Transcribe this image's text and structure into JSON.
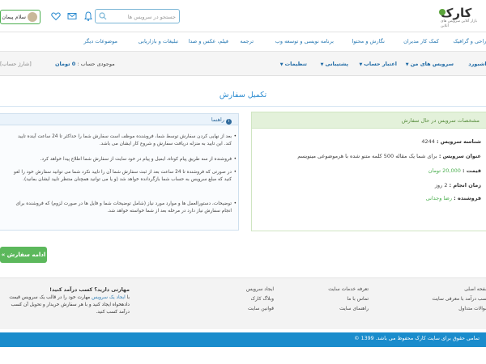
{
  "header": {
    "logo_text": "کارک",
    "logo_sub": "بازار آنلاین سرویس های آنلاین",
    "search_placeholder": "جستجو در سرویس ها",
    "user_name": "سلام پیمان"
  },
  "categories": [
    "طراحی و گرافیک",
    "کمک کار مدیران",
    "نگارش و محتوا",
    "برنامه نویسی و توسعه وب",
    "ترجمه",
    "فیلم، عکس و صدا",
    "تبلیغات و بازاریابی",
    "موضوعات دیگر"
  ],
  "dashboard": {
    "items": [
      "داشبورد",
      "سرویس های من",
      "اعتبار حساب",
      "پشتیبانی",
      "تنظیمات"
    ],
    "balance_label": "موجودی حساب :",
    "balance_value": "0 تومان",
    "charge_link": "[شارژ حساب]"
  },
  "page_title": "تکمیل سفارش",
  "order": {
    "header": "مشخصات سرویس در حال سفارش",
    "rows": [
      {
        "label": "شناسه سرویس :",
        "value": "4244",
        "green": false
      },
      {
        "label": "عنوان سرویس :",
        "value": "برای شما یک مقاله 500 کلمه متنو شده با هرموضوعی مینویسم",
        "green": false
      },
      {
        "label": "قیمت :",
        "value": "20,000 تومان",
        "green": true
      },
      {
        "label": "زمان انجام :",
        "value": "2 روز",
        "green": false
      },
      {
        "label": "فروشنده :",
        "value": "رضا وجدانی",
        "green": true
      }
    ]
  },
  "guide": {
    "header": "راهنما",
    "items": [
      "بعد از نهایی کردن سفارش توسط شما، فروشنده موظف است سفارش شما را حداکثر تا 24 ساعت آینده تایید کند. این تایید به منزله دریافت سفارش و شروع کار ایشان می باشد.",
      "فروشنده از سه طریق پیام کوتاه، ایمیل و پیام در خود سایت از سفارش شما اطلاع پیدا خواهد کرد.",
      "در صورتی که فروشنده تا 24 ساعت بعد از ثبت سفارش شما آن را تایید نکرد شما می توانید سفارش خود را لغو کنید که مبلغ سرویس به حساب شما بازگردانده خواهد شد (و یا می توانید همچنان منتظر تایید ایشان بمانید).",
      "توضیحات، دستورالعمل ها و موارد مورد نیاز (شامل توضیحات شما و فایل ها در صورت لزوم) که فروشنده برای انجام سفارش نیاز دارد در مرحله بعد از شما خواسته خواهد شد."
    ]
  },
  "continue_button": "ادامه سفارش »",
  "footer": {
    "col1": [
      "صفحه اصلی",
      "کسب درآمد با معرفی سایت",
      "سوالات متداول"
    ],
    "col2": [
      "تعرفه خدمات سایت",
      "تماس با ما",
      "راهنمای سایت"
    ],
    "col3": [
      "ایجاد سرویس",
      "وبلاگ کارک",
      "قوانین سایت"
    ],
    "promo_title": "مهارتی دارید؟ کسب درآمد کنید!",
    "promo_text_1": "با",
    "promo_link": "ایجاد یک سرویس",
    "promo_text_2": "مهارت خود را در قالب یک سرویس قیمت دادهخواه ایجاد کنید و با هر سفارش خریدار و تحویل آن کسب درآمد کسب کنید.",
    "copyright": "تمامی حقوق برای سایت کارک محفوظ می باشد. 1399 ©"
  },
  "colors": {
    "primary_blue": "#2b8bd0",
    "green": "#5cb85c",
    "footer_bar": "#1a8ccc"
  }
}
